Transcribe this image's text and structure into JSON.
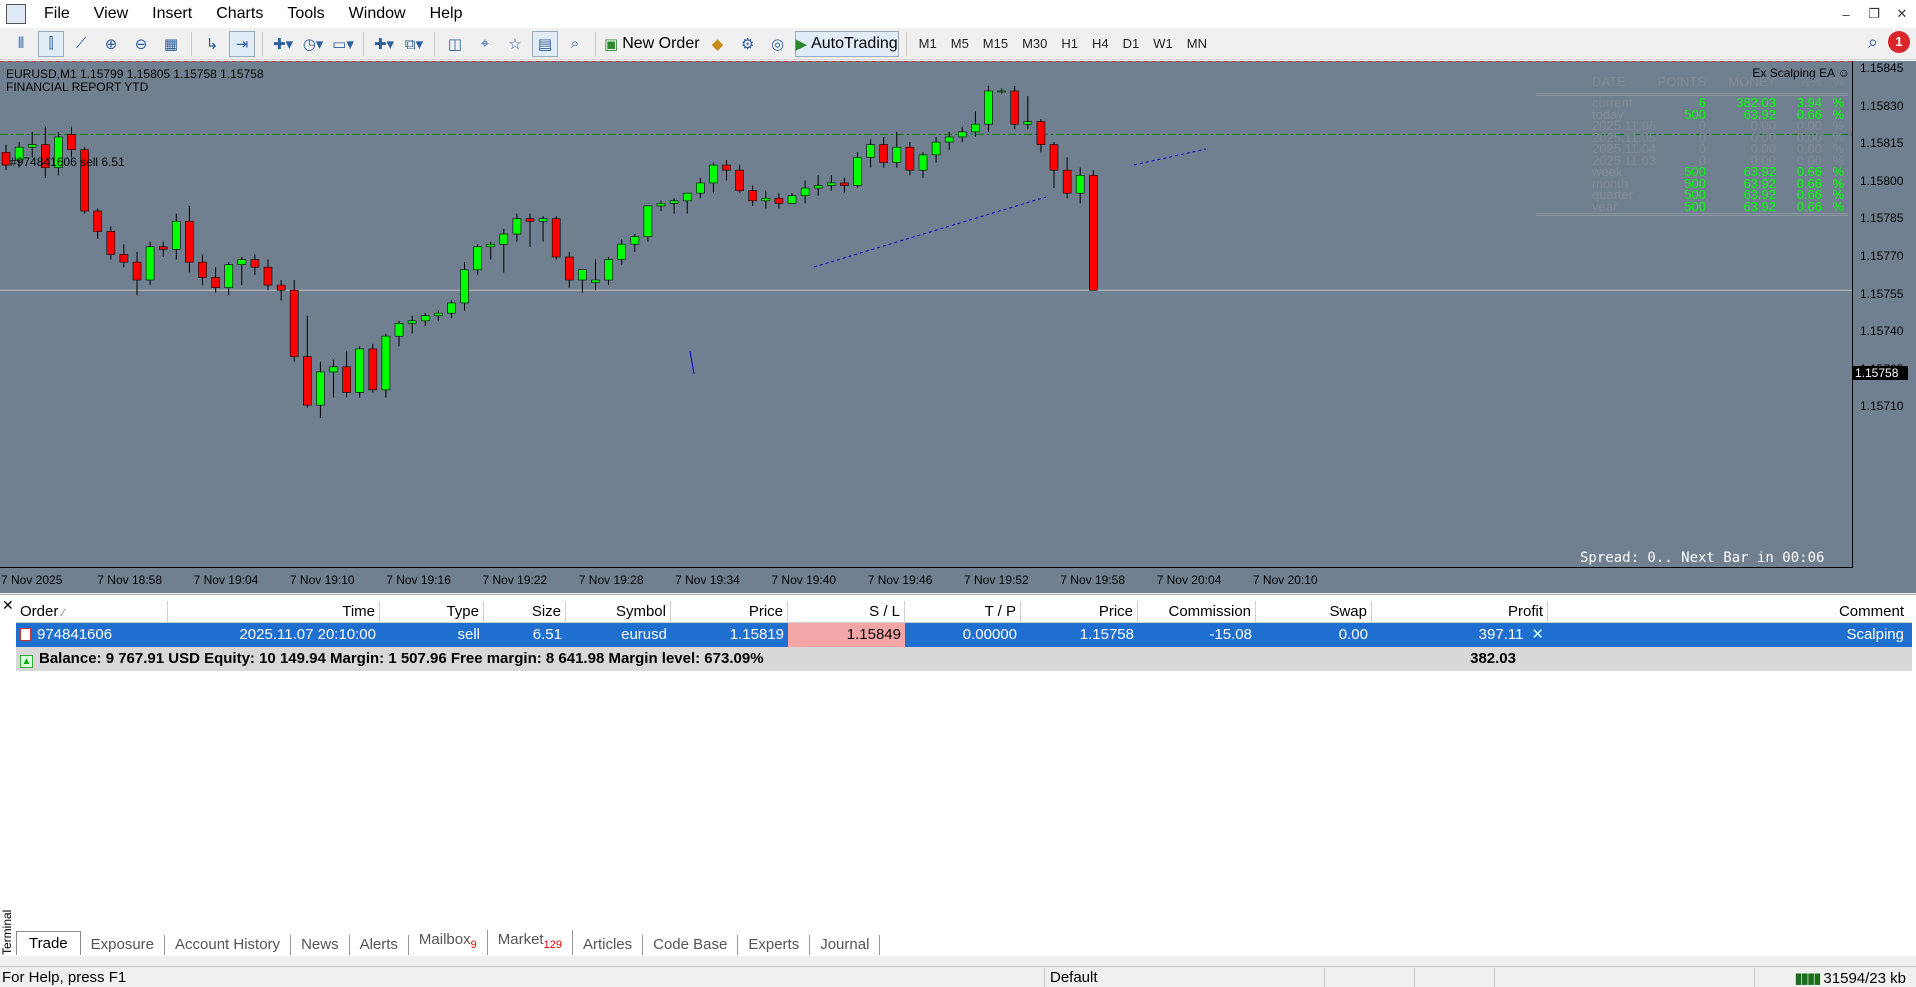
{
  "menu": [
    "File",
    "View",
    "Insert",
    "Charts",
    "Tools",
    "Window",
    "Help"
  ],
  "toolbar": {
    "new_order": "New Order",
    "autotrading": "AutoTrading",
    "timeframes": [
      "M1",
      "M5",
      "M15",
      "M30",
      "H1",
      "H4",
      "D1",
      "W1",
      "MN"
    ],
    "notification_count": "1"
  },
  "chart": {
    "title": "EURUSD,M1  1.15799 1.15805 1.15758 1.15758",
    "subtitle": "FINANCIAL REPORT YTD",
    "ea_label": "Ex Scalping EA ☺",
    "order_label": "#974841606 sell 6.51",
    "current_price_tag": "1.15758",
    "spread_text": "Spread: 0.. Next Bar in 00:06",
    "price_axis": [
      "1.15845",
      "1.15830",
      "1.15815",
      "1.15800",
      "1.15785",
      "1.15770",
      "1.15755",
      "1.15740",
      "1.15725",
      "1.15710"
    ],
    "time_axis": [
      "7 Nov 2025",
      "7 Nov 18:58",
      "7 Nov 19:04",
      "7 Nov 19:10",
      "7 Nov 19:16",
      "7 Nov 19:22",
      "7 Nov 19:28",
      "7 Nov 19:34",
      "7 Nov 19:40",
      "7 Nov 19:46",
      "7 Nov 19:52",
      "7 Nov 19:58",
      "7 Nov 20:04",
      "7 Nov 20:10"
    ],
    "colors": {
      "background": "#708090",
      "bull": "#00ff00",
      "bear": "#ff0000",
      "order_line": "#008000",
      "bid_line": "#c0c0c0"
    },
    "report": {
      "headers": [
        "DATE",
        "POINTS",
        "MONEY",
        "%%",
        "%"
      ],
      "rows": [
        {
          "label": "current",
          "points": "6",
          "money": "382.03",
          "pct": "3.94",
          "unit": "%",
          "style": "g"
        },
        {
          "label": "today",
          "points": "500",
          "money": "63.92",
          "pct": "0.66",
          "unit": "%",
          "style": "g"
        },
        {
          "label": "2025.11.06",
          "points": "0",
          "money": "0.00",
          "pct": "0.00",
          "unit": "%",
          "style": "d"
        },
        {
          "label": "2025.11.05",
          "points": "0",
          "money": "0.00",
          "pct": "0.00",
          "unit": "%",
          "style": "d"
        },
        {
          "label": "2025.11.04",
          "points": "0",
          "money": "0.00",
          "pct": "0.00",
          "unit": "%",
          "style": "d"
        },
        {
          "label": "2025.11.03",
          "points": "0",
          "money": "0.00",
          "pct": "0.00",
          "unit": "%",
          "style": "d"
        },
        {
          "label": "week",
          "points": "500",
          "money": "63.92",
          "pct": "0.66",
          "unit": "%",
          "style": "g"
        },
        {
          "label": "month",
          "points": "500",
          "money": "63.92",
          "pct": "0.66",
          "unit": "%",
          "style": "g"
        },
        {
          "label": "quarter",
          "points": "500",
          "money": "63.92",
          "pct": "0.66",
          "unit": "%",
          "style": "g"
        },
        {
          "label": "year",
          "points": "500",
          "money": "63.92",
          "pct": "0.66",
          "unit": "%",
          "style": "g"
        }
      ]
    }
  },
  "chart_data": {
    "type": "candlestick",
    "symbol": "EURUSD",
    "timeframe": "M1",
    "ylim": [
      1.15703,
      1.15852
    ],
    "order_price": 1.15819,
    "bid": 1.15758,
    "candles": [
      [
        1.15812,
        1.15815,
        1.15805,
        1.15807
      ],
      [
        1.15809,
        1.15816,
        1.15806,
        1.15814
      ],
      [
        1.15814,
        1.1582,
        1.1581,
        1.15815
      ],
      [
        1.15815,
        1.15822,
        1.15802,
        1.15806
      ],
      [
        1.15806,
        1.1582,
        1.15803,
        1.15818
      ],
      [
        1.15819,
        1.15822,
        1.1581,
        1.15813
      ],
      [
        1.15813,
        1.15814,
        1.15788,
        1.15789
      ],
      [
        1.15789,
        1.1579,
        1.15778,
        1.15781
      ],
      [
        1.15781,
        1.15783,
        1.1577,
        1.15772
      ],
      [
        1.15772,
        1.15776,
        1.15767,
        1.15769
      ],
      [
        1.15769,
        1.15773,
        1.15756,
        1.15762
      ],
      [
        1.15762,
        1.15777,
        1.1576,
        1.15775
      ],
      [
        1.15775,
        1.15777,
        1.15771,
        1.15774
      ],
      [
        1.15774,
        1.15788,
        1.1577,
        1.15785
      ],
      [
        1.15785,
        1.15791,
        1.15765,
        1.15769
      ],
      [
        1.15769,
        1.15772,
        1.1576,
        1.15763
      ],
      [
        1.15763,
        1.15767,
        1.15757,
        1.15759
      ],
      [
        1.15759,
        1.15769,
        1.15756,
        1.15768
      ],
      [
        1.15768,
        1.15771,
        1.1576,
        1.1577
      ],
      [
        1.1577,
        1.15772,
        1.15764,
        1.15767
      ],
      [
        1.15767,
        1.1577,
        1.15758,
        1.1576
      ],
      [
        1.1576,
        1.15762,
        1.15754,
        1.15758
      ],
      [
        1.15758,
        1.15762,
        1.1573,
        1.15732
      ],
      [
        1.15732,
        1.15748,
        1.15712,
        1.15713
      ],
      [
        1.15713,
        1.1573,
        1.15708,
        1.15726
      ],
      [
        1.15726,
        1.15731,
        1.15716,
        1.15728
      ],
      [
        1.15728,
        1.15734,
        1.15716,
        1.15718
      ],
      [
        1.15718,
        1.15736,
        1.15716,
        1.15735
      ],
      [
        1.15735,
        1.15737,
        1.15718,
        1.15719
      ],
      [
        1.15719,
        1.15741,
        1.15716,
        1.1574
      ],
      [
        1.1574,
        1.15746,
        1.15736,
        1.15745
      ],
      [
        1.15745,
        1.15748,
        1.15741,
        1.15746
      ],
      [
        1.15746,
        1.15749,
        1.15744,
        1.15748
      ],
      [
        1.15748,
        1.1575,
        1.15746,
        1.15749
      ],
      [
        1.15749,
        1.15754,
        1.15747,
        1.15753
      ],
      [
        1.15753,
        1.15769,
        1.1575,
        1.15766
      ],
      [
        1.15766,
        1.15776,
        1.15764,
        1.15775
      ],
      [
        1.15775,
        1.15777,
        1.1577,
        1.15776
      ],
      [
        1.15776,
        1.15782,
        1.15765,
        1.1578
      ],
      [
        1.1578,
        1.15788,
        1.15777,
        1.15786
      ],
      [
        1.15786,
        1.15788,
        1.15775,
        1.15785
      ],
      [
        1.15785,
        1.15787,
        1.15777,
        1.15786
      ],
      [
        1.15786,
        1.15787,
        1.1577,
        1.15771
      ],
      [
        1.15771,
        1.15773,
        1.15759,
        1.15762
      ],
      [
        1.15762,
        1.15766,
        1.15757,
        1.15766
      ],
      [
        1.15761,
        1.1577,
        1.15758,
        1.15762
      ],
      [
        1.15762,
        1.15771,
        1.1576,
        1.1577
      ],
      [
        1.1577,
        1.15778,
        1.15768,
        1.15776
      ],
      [
        1.15776,
        1.1578,
        1.15773,
        1.15779
      ],
      [
        1.15779,
        1.15791,
        1.15777,
        1.15791
      ],
      [
        1.15791,
        1.15793,
        1.15789,
        1.15792
      ],
      [
        1.15792,
        1.15794,
        1.15788,
        1.15793
      ],
      [
        1.15793,
        1.15796,
        1.15788,
        1.15796
      ],
      [
        1.15796,
        1.15802,
        1.15794,
        1.158
      ],
      [
        1.158,
        1.15808,
        1.15796,
        1.15807
      ],
      [
        1.15807,
        1.15809,
        1.15801,
        1.15805
      ],
      [
        1.15805,
        1.15807,
        1.15796,
        1.15797
      ],
      [
        1.15797,
        1.15799,
        1.15791,
        1.15793
      ],
      [
        1.15793,
        1.15797,
        1.1579,
        1.15794
      ],
      [
        1.15794,
        1.15796,
        1.1579,
        1.15792
      ],
      [
        1.15792,
        1.15796,
        1.15792,
        1.15795
      ],
      [
        1.15795,
        1.15801,
        1.15792,
        1.15798
      ],
      [
        1.15798,
        1.15803,
        1.15795,
        1.15799
      ],
      [
        1.15799,
        1.15803,
        1.15797,
        1.158
      ],
      [
        1.158,
        1.15802,
        1.15796,
        1.15799
      ],
      [
        1.15799,
        1.15812,
        1.15798,
        1.1581
      ],
      [
        1.1581,
        1.15817,
        1.15806,
        1.15815
      ],
      [
        1.15815,
        1.15818,
        1.15806,
        1.15808
      ],
      [
        1.15808,
        1.1582,
        1.15806,
        1.15814
      ],
      [
        1.15814,
        1.15816,
        1.15803,
        1.15805
      ],
      [
        1.15805,
        1.15812,
        1.15802,
        1.15811
      ],
      [
        1.15811,
        1.15818,
        1.15808,
        1.15816
      ],
      [
        1.15816,
        1.1582,
        1.15813,
        1.15818
      ],
      [
        1.15818,
        1.15822,
        1.15816,
        1.1582
      ],
      [
        1.1582,
        1.15828,
        1.15818,
        1.15823
      ],
      [
        1.15823,
        1.15838,
        1.1582,
        1.15836
      ],
      [
        1.15836,
        1.15837,
        1.15835,
        1.15836
      ],
      [
        1.15836,
        1.15838,
        1.15821,
        1.15823
      ],
      [
        1.15823,
        1.15834,
        1.15821,
        1.15824
      ],
      [
        1.15824,
        1.15825,
        1.15812,
        1.15815
      ],
      [
        1.15815,
        1.15816,
        1.15798,
        1.15805
      ],
      [
        1.15805,
        1.1581,
        1.15794,
        1.15796
      ],
      [
        1.15796,
        1.15806,
        1.15792,
        1.15803
      ],
      [
        1.15803,
        1.15805,
        1.15758,
        1.15758
      ]
    ]
  },
  "terminal": {
    "columns": [
      "Order",
      "Time",
      "Type",
      "Size",
      "Symbol",
      "Price",
      "S / L",
      "T / P",
      "Price",
      "Commission",
      "Swap",
      "Profit",
      "Comment"
    ],
    "order": {
      "id": "974841606",
      "time": "2025.11.07 20:10:00",
      "type": "sell",
      "size": "6.51",
      "symbol": "eurusd",
      "price": "1.15819",
      "sl": "1.15849",
      "tp": "0.00000",
      "current_price": "1.15758",
      "commission": "-15.08",
      "swap": "0.00",
      "profit": "397.11",
      "comment": "Scalping"
    },
    "balance_text": "Balance: 9 767.91 USD  Equity: 10 149.94  Margin: 1 507.96  Free margin: 8 641.98  Margin level: 673.09%",
    "total_profit": "382.03",
    "side_label": "Terminal",
    "tabs": [
      {
        "label": "Trade",
        "badge": ""
      },
      {
        "label": "Exposure",
        "badge": ""
      },
      {
        "label": "Account History",
        "badge": ""
      },
      {
        "label": "News",
        "badge": ""
      },
      {
        "label": "Alerts",
        "badge": ""
      },
      {
        "label": "Mailbox",
        "badge": "9"
      },
      {
        "label": "Market",
        "badge": "129"
      },
      {
        "label": "Articles",
        "badge": ""
      },
      {
        "label": "Code Base",
        "badge": ""
      },
      {
        "label": "Experts",
        "badge": ""
      },
      {
        "label": "Journal",
        "badge": ""
      }
    ]
  },
  "status": {
    "help": "For Help, press F1",
    "profile": "Default",
    "traffic": "31594/23 kb"
  }
}
